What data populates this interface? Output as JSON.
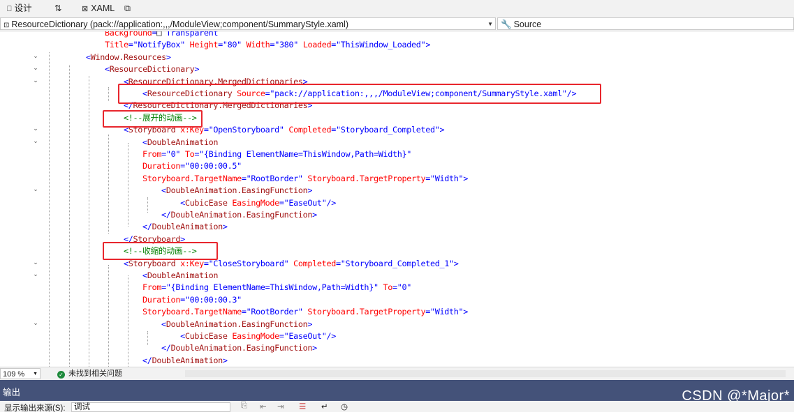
{
  "tabs": {
    "design": "设计",
    "swap": "⇅",
    "xaml": "XAML"
  },
  "navbar": {
    "element_combo": "ResourceDictionary (pack://application:,,,/ModuleView;component/SummaryStyle.xaml)",
    "source_combo": "Source"
  },
  "code_lines": [
    [
      [
        "        ",
        "t-txt"
      ],
      [
        "Background",
        "t-attr"
      ],
      [
        "=",
        "t-pun"
      ],
      [
        "□ ",
        "t-txt"
      ],
      [
        "Transparent",
        "t-val"
      ]
    ],
    [
      [
        "        ",
        "t-txt"
      ],
      [
        "Title",
        "t-attr"
      ],
      [
        "=\"",
        "t-pun"
      ],
      [
        "NotifyBox",
        "t-val"
      ],
      [
        "\" ",
        "t-pun"
      ],
      [
        "Height",
        "t-attr"
      ],
      [
        "=\"",
        "t-pun"
      ],
      [
        "80",
        "t-val"
      ],
      [
        "\" ",
        "t-pun"
      ],
      [
        "Width",
        "t-attr"
      ],
      [
        "=\"",
        "t-pun"
      ],
      [
        "380",
        "t-val"
      ],
      [
        "\" ",
        "t-pun"
      ],
      [
        "Loaded",
        "t-attr"
      ],
      [
        "=\"",
        "t-pun"
      ],
      [
        "ThisWindow_Loaded",
        "t-val"
      ],
      [
        "\">",
        "t-pun"
      ]
    ],
    [
      [
        "    ",
        "t-txt"
      ],
      [
        "<",
        "t-pun"
      ],
      [
        "Window.Resources",
        "t-tag"
      ],
      [
        ">",
        "t-pun"
      ]
    ],
    [
      [
        "        ",
        "t-txt"
      ],
      [
        "<",
        "t-pun"
      ],
      [
        "ResourceDictionary",
        "t-tag"
      ],
      [
        ">",
        "t-pun"
      ]
    ],
    [
      [
        "            ",
        "t-txt"
      ],
      [
        "<",
        "t-pun"
      ],
      [
        "ResourceDictionary.MergedDictionaries",
        "t-tag"
      ],
      [
        ">",
        "t-pun"
      ]
    ],
    [
      [
        "                ",
        "t-txt"
      ],
      [
        "<",
        "t-pun"
      ],
      [
        "ResourceDictionary ",
        "t-tag"
      ],
      [
        "Source",
        "t-attr"
      ],
      [
        "=\"",
        "t-pun"
      ],
      [
        "pack://application:,,,/ModuleView;component/SummaryStyle.xaml",
        "t-val"
      ],
      [
        "\"/>",
        "t-pun"
      ]
    ],
    [
      [
        "            ",
        "t-txt"
      ],
      [
        "</",
        "t-pun"
      ],
      [
        "ResourceDictionary.MergedDictionaries",
        "t-tag"
      ],
      [
        ">",
        "t-pun"
      ]
    ],
    [
      [
        "            ",
        "t-txt"
      ],
      [
        "<!--展开的动画-->",
        "t-com"
      ]
    ],
    [
      [
        "            ",
        "t-txt"
      ],
      [
        "<",
        "t-pun"
      ],
      [
        "Storyboard ",
        "t-tag"
      ],
      [
        "x:Key",
        "t-attr"
      ],
      [
        "=\"",
        "t-pun"
      ],
      [
        "OpenStoryboard",
        "t-val"
      ],
      [
        "\" ",
        "t-pun"
      ],
      [
        "Completed",
        "t-attr"
      ],
      [
        "=\"",
        "t-pun"
      ],
      [
        "Storyboard_Completed",
        "t-val"
      ],
      [
        "\">",
        "t-pun"
      ]
    ],
    [
      [
        "                ",
        "t-txt"
      ],
      [
        "<",
        "t-pun"
      ],
      [
        "DoubleAnimation",
        "t-tag"
      ]
    ],
    [
      [
        "                ",
        "t-txt"
      ],
      [
        "From",
        "t-attr"
      ],
      [
        "=\"",
        "t-pun"
      ],
      [
        "0",
        "t-val"
      ],
      [
        "\" ",
        "t-pun"
      ],
      [
        "To",
        "t-attr"
      ],
      [
        "=\"",
        "t-pun"
      ],
      [
        "{Binding ElementName=ThisWindow,Path=Width}",
        "t-val"
      ],
      [
        "\"",
        "t-pun"
      ]
    ],
    [
      [
        "                ",
        "t-txt"
      ],
      [
        "Duration",
        "t-attr"
      ],
      [
        "=\"",
        "t-pun"
      ],
      [
        "00:00:00.5",
        "t-val"
      ],
      [
        "\"",
        "t-pun"
      ]
    ],
    [
      [
        "                ",
        "t-txt"
      ],
      [
        "Storyboard.TargetName",
        "t-attr"
      ],
      [
        "=\"",
        "t-pun"
      ],
      [
        "RootBorder",
        "t-val"
      ],
      [
        "\" ",
        "t-pun"
      ],
      [
        "Storyboard.TargetProperty",
        "t-attr"
      ],
      [
        "=\"",
        "t-pun"
      ],
      [
        "Width",
        "t-val"
      ],
      [
        "\">",
        "t-pun"
      ]
    ],
    [
      [
        "                    ",
        "t-txt"
      ],
      [
        "<",
        "t-pun"
      ],
      [
        "DoubleAnimation.EasingFunction",
        "t-tag"
      ],
      [
        ">",
        "t-pun"
      ]
    ],
    [
      [
        "                        ",
        "t-txt"
      ],
      [
        "<",
        "t-pun"
      ],
      [
        "CubicEase ",
        "t-tag"
      ],
      [
        "EasingMode",
        "t-attr"
      ],
      [
        "=\"",
        "t-pun"
      ],
      [
        "EaseOut",
        "t-val"
      ],
      [
        "\"/>",
        "t-pun"
      ]
    ],
    [
      [
        "                    ",
        "t-txt"
      ],
      [
        "</",
        "t-pun"
      ],
      [
        "DoubleAnimation.EasingFunction",
        "t-tag"
      ],
      [
        ">",
        "t-pun"
      ]
    ],
    [
      [
        "                ",
        "t-txt"
      ],
      [
        "</",
        "t-pun"
      ],
      [
        "DoubleAnimation",
        "t-tag"
      ],
      [
        ">",
        "t-pun"
      ]
    ],
    [
      [
        "            ",
        "t-txt"
      ],
      [
        "</",
        "t-pun"
      ],
      [
        "Storyboard",
        "t-tag"
      ],
      [
        ">",
        "t-pun"
      ]
    ],
    [
      [
        "            ",
        "t-txt"
      ],
      [
        "<!--收缩的动画-->",
        "t-com"
      ]
    ],
    [
      [
        "            ",
        "t-txt"
      ],
      [
        "<",
        "t-pun"
      ],
      [
        "Storyboard ",
        "t-tag"
      ],
      [
        "x:Key",
        "t-attr"
      ],
      [
        "=\"",
        "t-pun"
      ],
      [
        "CloseStoryboard",
        "t-val"
      ],
      [
        "\" ",
        "t-pun"
      ],
      [
        "Completed",
        "t-attr"
      ],
      [
        "=\"",
        "t-pun"
      ],
      [
        "Storyboard_Completed_1",
        "t-val"
      ],
      [
        "\">",
        "t-pun"
      ]
    ],
    [
      [
        "                ",
        "t-txt"
      ],
      [
        "<",
        "t-pun"
      ],
      [
        "DoubleAnimation",
        "t-tag"
      ]
    ],
    [
      [
        "                ",
        "t-txt"
      ],
      [
        "From",
        "t-attr"
      ],
      [
        "=\"",
        "t-pun"
      ],
      [
        "{Binding ElementName=ThisWindow,Path=Width}",
        "t-val"
      ],
      [
        "\" ",
        "t-pun"
      ],
      [
        "To",
        "t-attr"
      ],
      [
        "=\"",
        "t-pun"
      ],
      [
        "0",
        "t-val"
      ],
      [
        "\"",
        "t-pun"
      ]
    ],
    [
      [
        "                ",
        "t-txt"
      ],
      [
        "Duration",
        "t-attr"
      ],
      [
        "=\"",
        "t-pun"
      ],
      [
        "00:00:00.3",
        "t-val"
      ],
      [
        "\"",
        "t-pun"
      ]
    ],
    [
      [
        "                ",
        "t-txt"
      ],
      [
        "Storyboard.TargetName",
        "t-attr"
      ],
      [
        "=\"",
        "t-pun"
      ],
      [
        "RootBorder",
        "t-val"
      ],
      [
        "\" ",
        "t-pun"
      ],
      [
        "Storyboard.TargetProperty",
        "t-attr"
      ],
      [
        "=\"",
        "t-pun"
      ],
      [
        "Width",
        "t-val"
      ],
      [
        "\">",
        "t-pun"
      ]
    ],
    [
      [
        "                    ",
        "t-txt"
      ],
      [
        "<",
        "t-pun"
      ],
      [
        "DoubleAnimation.EasingFunction",
        "t-tag"
      ],
      [
        ">",
        "t-pun"
      ]
    ],
    [
      [
        "                        ",
        "t-txt"
      ],
      [
        "<",
        "t-pun"
      ],
      [
        "CubicEase ",
        "t-tag"
      ],
      [
        "EasingMode",
        "t-attr"
      ],
      [
        "=\"",
        "t-pun"
      ],
      [
        "EaseOut",
        "t-val"
      ],
      [
        "\"/>",
        "t-pun"
      ]
    ],
    [
      [
        "                    ",
        "t-txt"
      ],
      [
        "</",
        "t-pun"
      ],
      [
        "DoubleAnimation.EasingFunction",
        "t-tag"
      ],
      [
        ">",
        "t-pun"
      ]
    ],
    [
      [
        "                ",
        "t-txt"
      ],
      [
        "</",
        "t-pun"
      ],
      [
        "DoubleAnimation",
        "t-tag"
      ],
      [
        ">",
        "t-pun"
      ]
    ]
  ],
  "status": {
    "zoom": "109 %",
    "issues": "未找到相关问题"
  },
  "output_panel": {
    "title": "输出",
    "source_label": "显示输出来源(S):",
    "source_value": "调试"
  },
  "watermark": "CSDN @*Major*",
  "colors": {
    "highlight_box": "#e8262d",
    "output_header": "#445279"
  }
}
